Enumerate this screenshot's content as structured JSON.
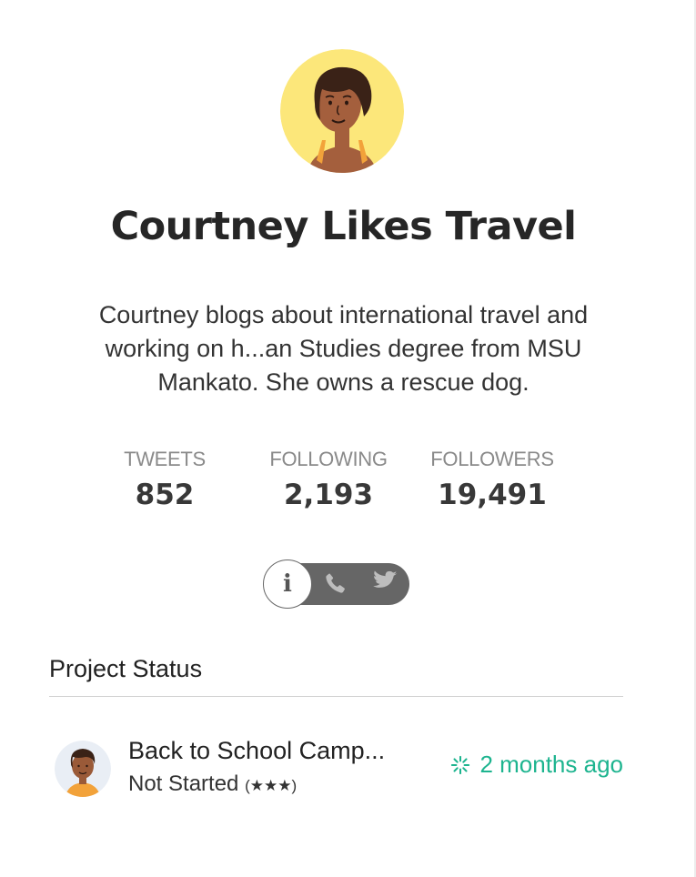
{
  "profile": {
    "name": "Courtney Likes Travel",
    "bio": "Courtney blogs about international travel and working on h...an Studies degree from MSU Mankato. She owns a rescue dog."
  },
  "stats": [
    {
      "label": "TWEETS",
      "value": "852"
    },
    {
      "label": "FOLLOWING",
      "value": "2,193"
    },
    {
      "label": "FOLLOWERS",
      "value": "19,491"
    }
  ],
  "toggle": {
    "active": "info-icon",
    "info_glyph": "i",
    "icons": [
      "info-icon",
      "phone-icon",
      "twitter-bird-icon"
    ]
  },
  "project_section": {
    "title": "Project Status",
    "items": [
      {
        "name": "Back to School Camp...",
        "status": "Not Started",
        "rating": "(★★★)",
        "updated": "2 months ago"
      }
    ]
  },
  "colors": {
    "avatar_bg": "#fce77a",
    "toggle_track": "#666666",
    "time_accent": "#1db48f"
  }
}
